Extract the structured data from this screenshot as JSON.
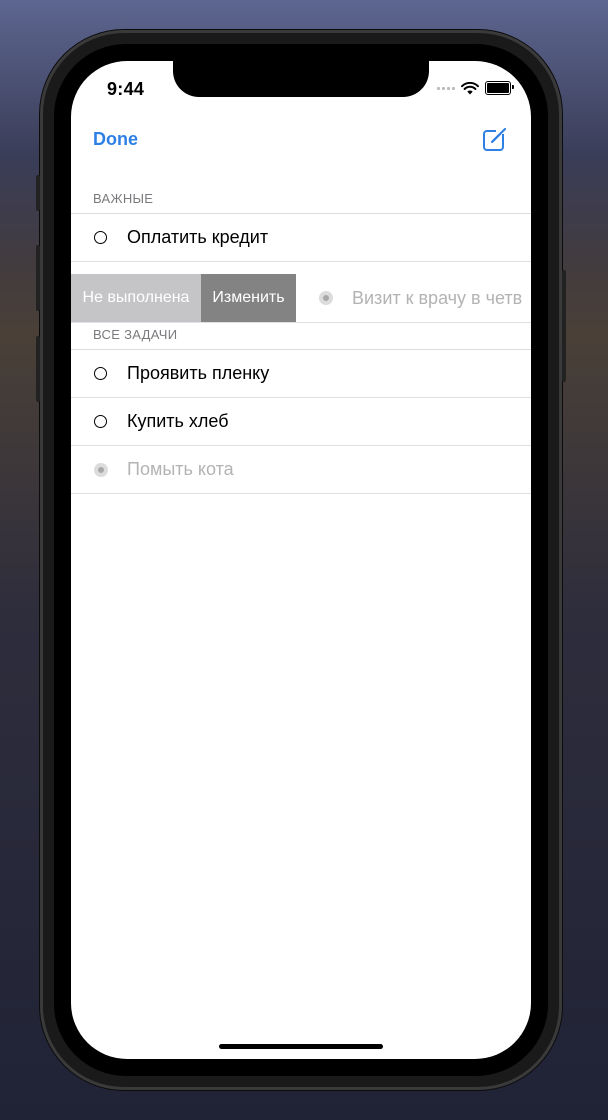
{
  "status_bar": {
    "time": "9:44"
  },
  "nav": {
    "done_label": "Done",
    "compose_icon": "compose-icon"
  },
  "sections": [
    {
      "header": "ВАЖНЫЕ",
      "rows": [
        {
          "title": "Оплатить кредит",
          "completed": false
        },
        {
          "title": "Визит к врачу в четв",
          "completed": true,
          "swiped": true
        }
      ]
    },
    {
      "header": "ВСЕ ЗАДАЧИ",
      "rows": [
        {
          "title": "Проявить пленку",
          "completed": false
        },
        {
          "title": "Купить хлеб",
          "completed": false
        },
        {
          "title": "Помыть кота",
          "completed": true
        }
      ]
    }
  ],
  "swipe_actions": {
    "undone_label": "Не выполнена",
    "edit_label": "Изменить"
  },
  "colors": {
    "accent": "#2f80e5",
    "action_undone": "#c5c5c8",
    "action_edit": "#838383",
    "completed_text": "#b3b3b3"
  }
}
